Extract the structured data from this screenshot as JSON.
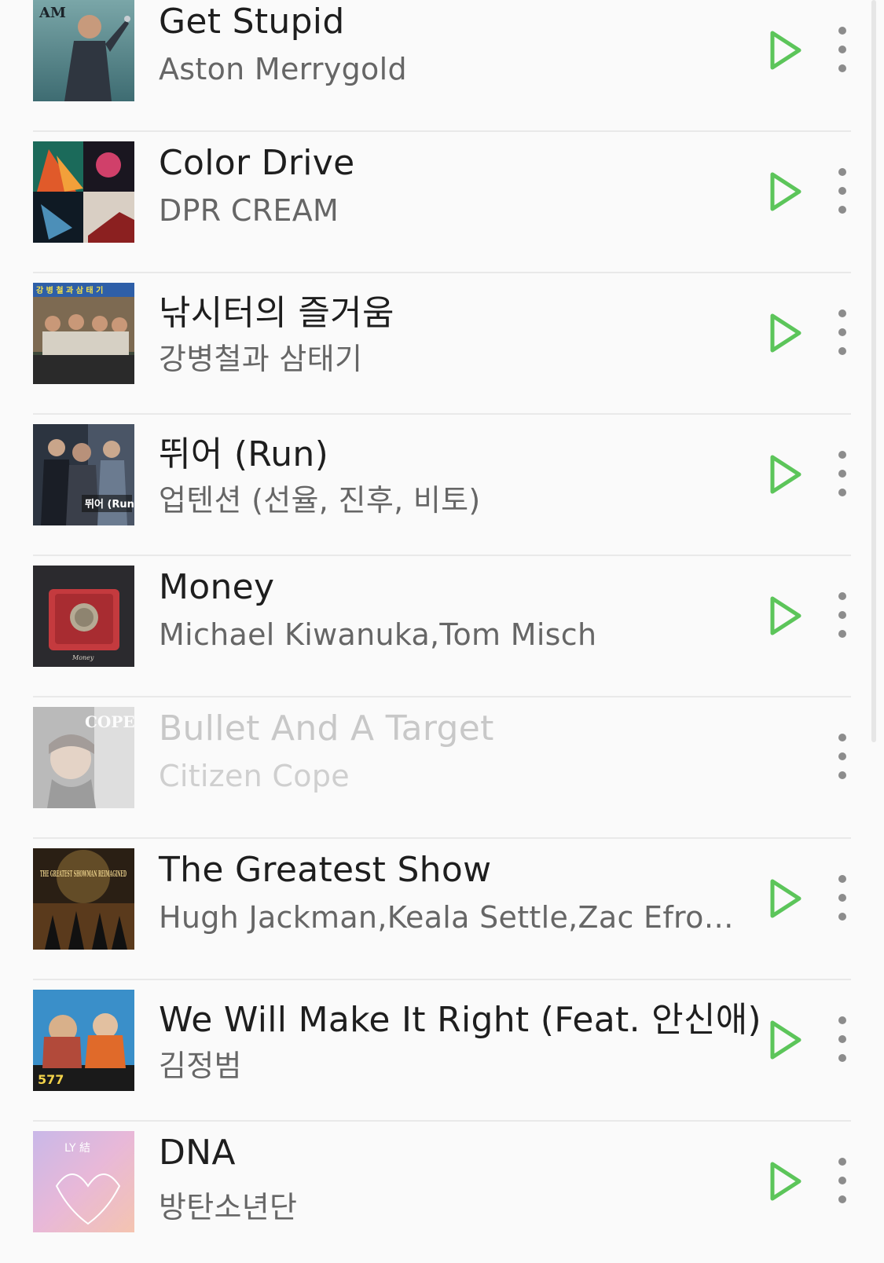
{
  "songs": [
    {
      "title": "Get Stupid",
      "artist": "Aston Merrygold",
      "playable": true,
      "art_icon": "album-art-get-stupid",
      "art_text": "AM"
    },
    {
      "title": "Color Drive",
      "artist": "DPR CREAM",
      "playable": true,
      "art_icon": "album-art-color-drive",
      "art_text": ""
    },
    {
      "title": "낚시터의 즐거움",
      "artist": "강병철과 삼태기",
      "playable": true,
      "art_icon": "album-art-fishing",
      "art_text": "강 병 철 과 삼 태 기"
    },
    {
      "title": "뛰어 (Run)",
      "artist": "업텐션 (선율, 진후, 비토)",
      "playable": true,
      "art_icon": "album-art-run",
      "art_text": "뛰어 (Run)"
    },
    {
      "title": "Money",
      "artist": "Michael Kiwanuka,Tom Misch",
      "playable": true,
      "art_icon": "album-art-money",
      "art_text": "Money"
    },
    {
      "title": "Bullet And A Target",
      "artist": "Citizen Cope",
      "playable": false,
      "art_icon": "album-art-citizen-cope",
      "art_text": "COPE"
    },
    {
      "title": "The Greatest Show",
      "artist": "Hugh Jackman,Keala Settle,Zac Efron,Z...",
      "playable": true,
      "art_icon": "album-art-greatest-showman",
      "art_text": "THE GREATEST SHOWMAN REIMAGINED"
    },
    {
      "title": "We Will Make It Right (Feat. 안신애)",
      "artist": "김정범",
      "playable": true,
      "art_icon": "album-art-577",
      "art_text": "577"
    },
    {
      "title": "DNA",
      "artist": "방탄소년단",
      "playable": true,
      "art_icon": "album-art-love-yourself",
      "art_text": "LY 結"
    }
  ],
  "colors": {
    "play_accent": "#5cc55a",
    "title_text": "#1e1e1e",
    "artist_text": "#666666",
    "disabled_text": "#c8c8c8",
    "divider": "#e9e9e9",
    "menu_dots": "#8c8c8c",
    "background": "#fafafa"
  }
}
